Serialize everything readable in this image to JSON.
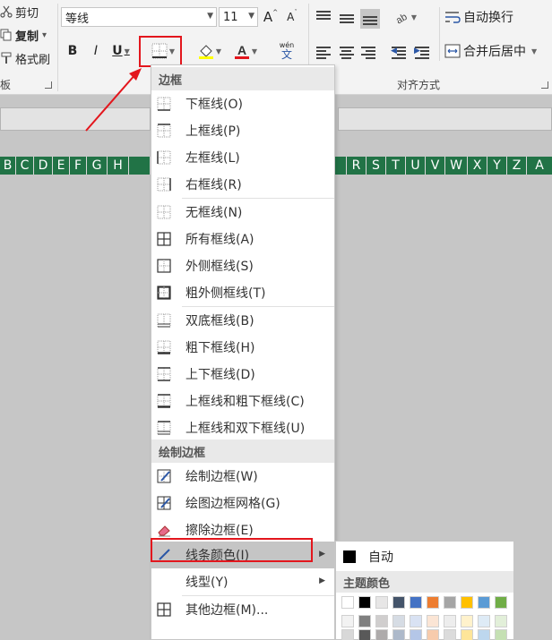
{
  "ribbon": {
    "clipboard": {
      "cut_label": "剪切",
      "copy_label": "复制",
      "copy_dropdown": "▾",
      "format_painter_label": "格式刷",
      "group_label": "板"
    },
    "font": {
      "font_name": "等线",
      "font_size": "11",
      "grow_label": "A",
      "shrink_label": "A",
      "bold": "B",
      "italic": "I",
      "underline": "U",
      "phonetic_top": "wén",
      "phonetic_bottom": "文"
    },
    "alignment": {
      "wrap_text_label": "自动换行",
      "merge_center_label": "合并后居中",
      "group_label": "对齐方式"
    }
  },
  "columns_left": [
    "B",
    "C",
    "D",
    "E",
    "F",
    "G",
    "H"
  ],
  "columns_right": [
    "R",
    "S",
    "T",
    "U",
    "V",
    "W",
    "X",
    "Y",
    "Z",
    "A"
  ],
  "column_partial_left": "R",
  "border_menu": {
    "section1_header": "边框",
    "items": [
      {
        "label": "下框线(O)",
        "icon": "bottom-border-icon"
      },
      {
        "label": "上框线(P)",
        "icon": "top-border-icon"
      },
      {
        "label": "左框线(L)",
        "icon": "left-border-icon"
      },
      {
        "label": "右框线(R)",
        "icon": "right-border-icon"
      },
      {
        "label": "无框线(N)",
        "icon": "no-border-icon"
      },
      {
        "label": "所有框线(A)",
        "icon": "all-borders-icon"
      },
      {
        "label": "外侧框线(S)",
        "icon": "outside-borders-icon"
      },
      {
        "label": "粗外侧框线(T)",
        "icon": "thick-outside-borders-icon"
      },
      {
        "label": "双底框线(B)",
        "icon": "double-bottom-border-icon"
      },
      {
        "label": "粗下框线(H)",
        "icon": "thick-bottom-border-icon"
      },
      {
        "label": "上下框线(D)",
        "icon": "top-bottom-border-icon"
      },
      {
        "label": "上框线和粗下框线(C)",
        "icon": "top-thick-bottom-border-icon"
      },
      {
        "label": "上框线和双下框线(U)",
        "icon": "top-double-bottom-border-icon"
      }
    ],
    "section2_header": "绘制边框",
    "draw_items": [
      {
        "label": "绘制边框(W)",
        "icon": "draw-border-icon"
      },
      {
        "label": "绘图边框网格(G)",
        "icon": "draw-border-grid-icon"
      },
      {
        "label": "擦除边框(E)",
        "icon": "eraser-icon"
      },
      {
        "label": "线条颜色(I)",
        "icon": "pen-color-icon"
      },
      {
        "label": "线型(Y)",
        "icon": ""
      },
      {
        "label": "其他边框(M)...",
        "icon": "more-borders-icon"
      }
    ]
  },
  "line_color_submenu": {
    "auto_label": "自动",
    "theme_header": "主题颜色",
    "theme_row1": [
      "#ffffff",
      "#000000",
      "#e7e6e6",
      "#44546a",
      "#4472c4",
      "#ed7d31",
      "#a5a5a5",
      "#ffc000",
      "#5b9bd5",
      "#70ad47"
    ],
    "theme_row2": [
      "#f2f2f2",
      "#7f7f7f",
      "#d0cece",
      "#d6dce4",
      "#d9e2f3",
      "#fbe5d5",
      "#ededed",
      "#fff2cc",
      "#deebf6",
      "#e2efd9"
    ],
    "theme_row3": [
      "#d8d8d8",
      "#595959",
      "#aeabab",
      "#adb9ca",
      "#b4c6e7",
      "#f7cbac",
      "#dbdbdb",
      "#fee599",
      "#bdd7ee",
      "#c5e0b3"
    ]
  },
  "colors": {
    "excel_green": "#217346",
    "annotation_red": "#e3161d"
  }
}
